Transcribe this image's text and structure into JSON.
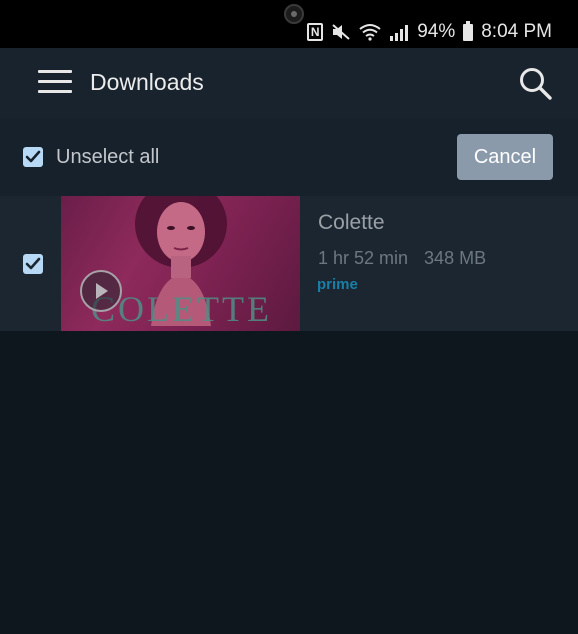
{
  "status_bar": {
    "nfc": "N",
    "battery_percent": "94%",
    "time": "8:04 PM",
    "icons": [
      "camera-icon",
      "nfc-icon",
      "mute-icon",
      "wifi-icon",
      "signal-icon",
      "battery-icon"
    ]
  },
  "app_bar": {
    "title": "Downloads",
    "icons": [
      "menu-icon",
      "search-icon"
    ]
  },
  "selection_bar": {
    "unselect_label": "Unselect all",
    "unselect_checked": true,
    "cancel_label": "Cancel"
  },
  "downloads": [
    {
      "title": "Colette",
      "duration": "1 hr 52 min",
      "size": "348 MB",
      "badge": "prime",
      "poster_text": "COLETTE",
      "checked": true
    }
  ],
  "colors": {
    "background": "#0f171e",
    "app_bar": "#18232d",
    "checkbox": "#b8d9f5",
    "cancel_button": "#8a9aab",
    "prime": "#1a7fa6"
  }
}
